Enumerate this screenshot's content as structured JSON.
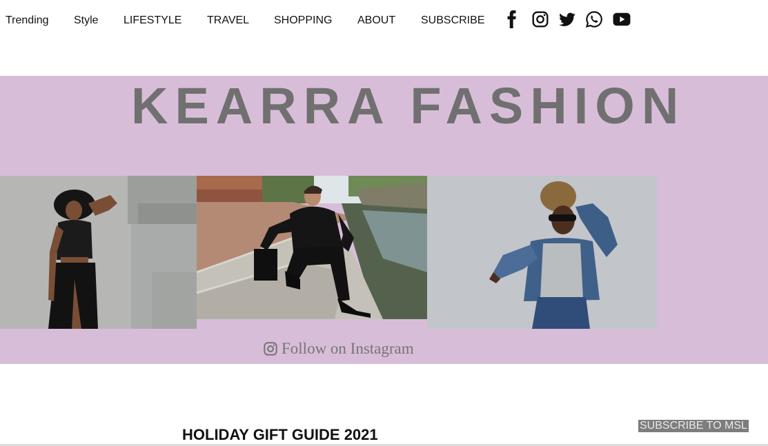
{
  "nav": {
    "items": [
      "Trending",
      "Style",
      "LIFESTYLE",
      "TRAVEL",
      "SHOPPING",
      "ABOUT",
      "SUBSCRIBE"
    ],
    "social_icons": [
      "facebook-icon",
      "instagram-icon",
      "twitter-icon",
      "whatsapp-icon",
      "youtube-icon"
    ]
  },
  "hero": {
    "brand": "KEARRA FASHION",
    "background_color": "#d8bdd8",
    "brand_color": "#707070",
    "follow_label": "Follow on Instagram"
  },
  "gallery": {
    "photos": [
      "woman-in-black-hat-photo",
      "man-in-leather-jacket-photo",
      "woman-in-denim-jacket-photo"
    ]
  },
  "post": {
    "title": "HOLIDAY GIFT GUIDE 2021"
  },
  "subscribe_button": {
    "label": "SUBSCRIBE TO MSL"
  }
}
